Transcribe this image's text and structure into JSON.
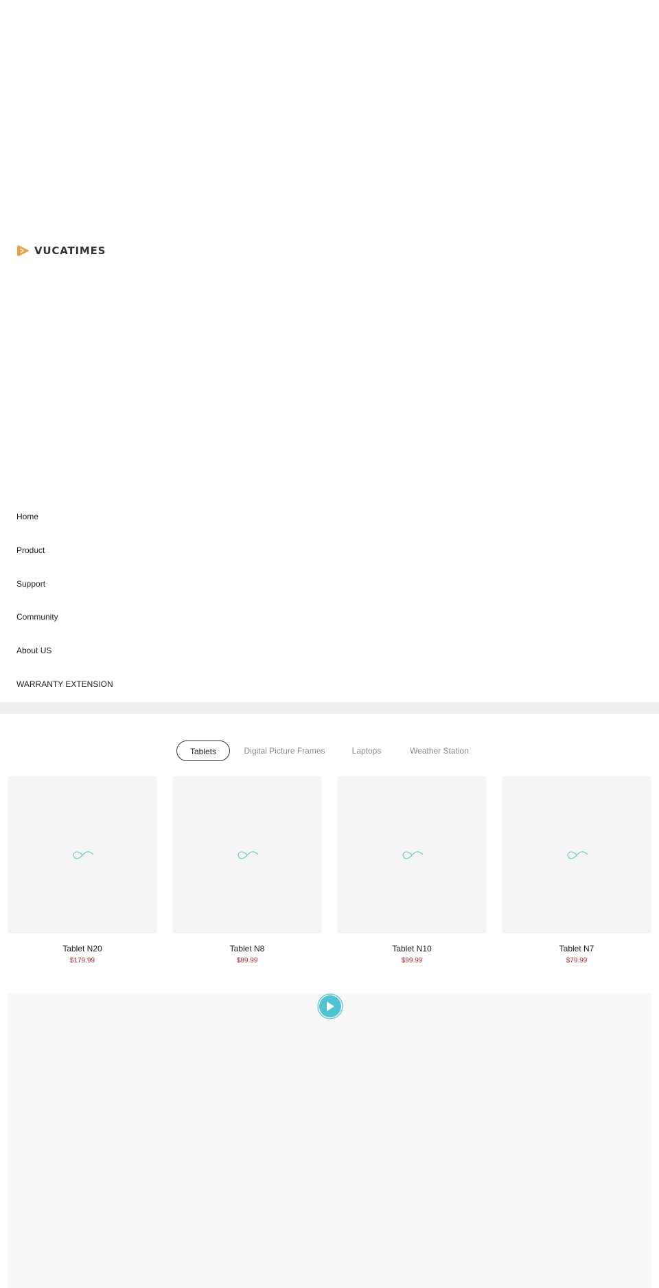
{
  "header": {
    "logo_text": "VUCATIMES",
    "logo_color": "#e9a24c"
  },
  "nav": {
    "items": [
      {
        "label": "Home"
      },
      {
        "label": "Product"
      },
      {
        "label": "Support"
      },
      {
        "label": "Community"
      },
      {
        "label": "About US"
      },
      {
        "label": "WARRANTY EXTENSION"
      }
    ]
  },
  "tabs": [
    {
      "label": "Tablets",
      "active": true
    },
    {
      "label": "Digital Picture Frames",
      "active": false
    },
    {
      "label": "Laptops",
      "active": false
    },
    {
      "label": "Weather Station",
      "active": false
    }
  ],
  "products": [
    {
      "name": "Tablet N20",
      "price": "$179.99"
    },
    {
      "name": "Tablet N8",
      "price": "$89.99"
    },
    {
      "name": "Tablet N10",
      "price": "$99.99"
    },
    {
      "name": "Tablet N7",
      "price": "$79.99"
    }
  ],
  "colors": {
    "price": "#b0272b",
    "loader": "#5bc8d6",
    "play_button": "#4fc3d4"
  },
  "icons": {
    "loader": "infinity-loader-icon",
    "play": "play-icon"
  }
}
